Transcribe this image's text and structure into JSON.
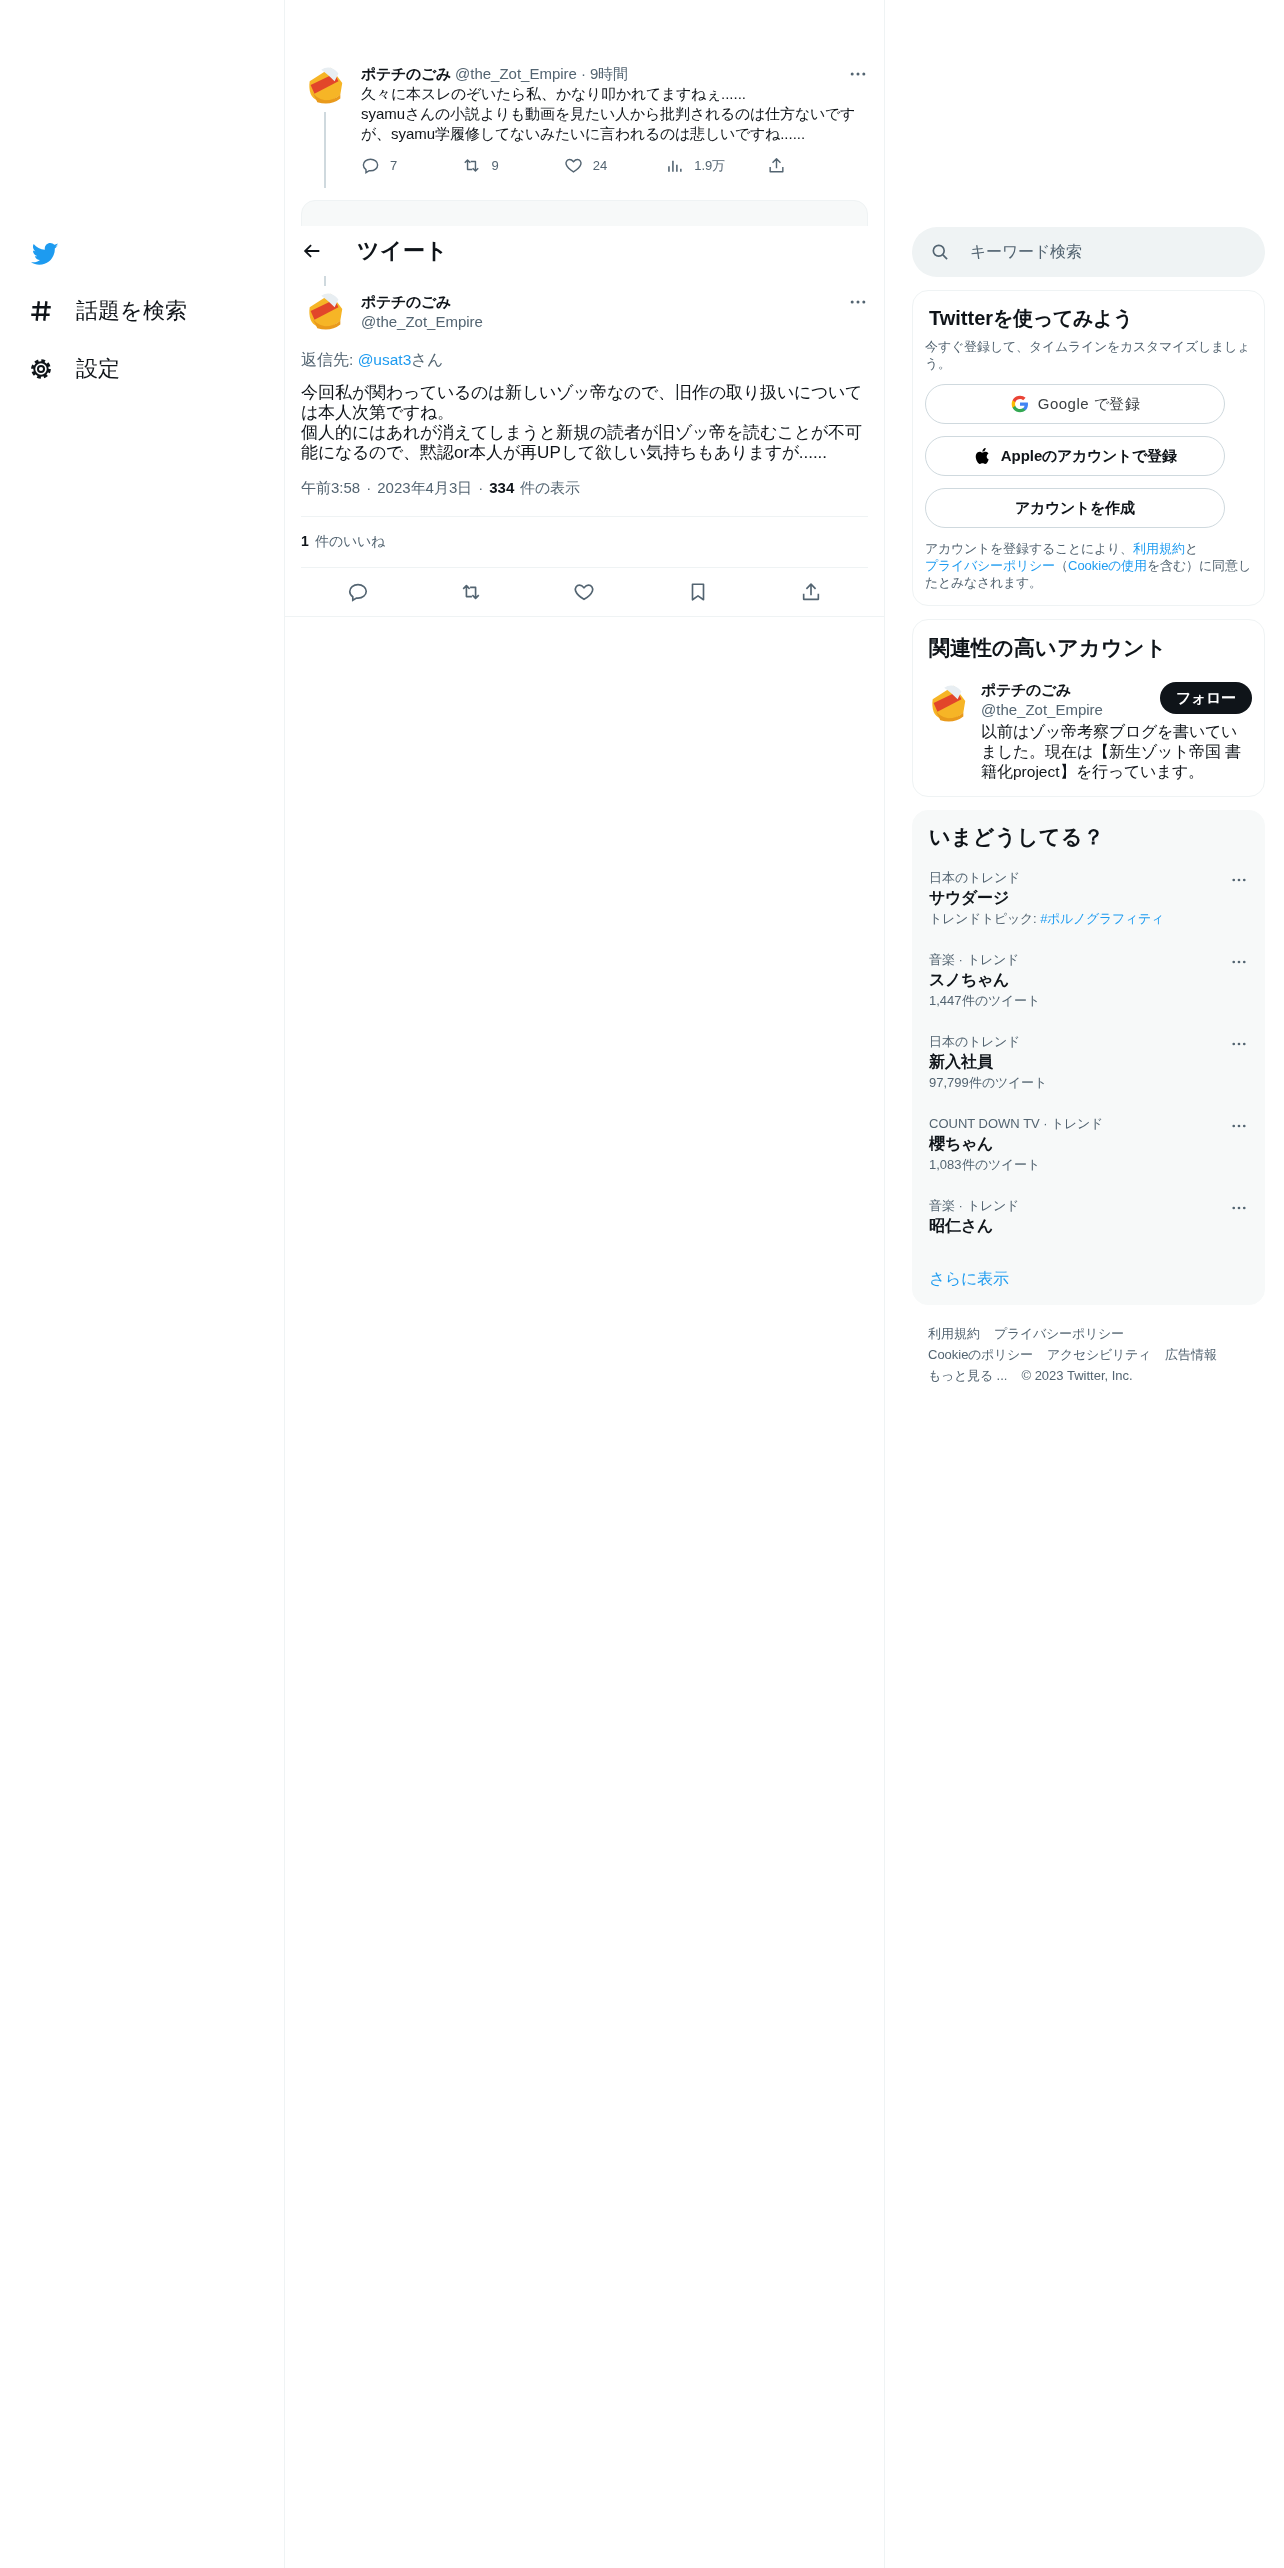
{
  "nav": {
    "items": [
      {
        "kind": "explore",
        "label": "話題を検索"
      },
      {
        "kind": "settings",
        "label": "設定"
      }
    ]
  },
  "parent_tweet": {
    "name": "ポテチのごみ",
    "handle": "@the_Zot_Empire",
    "dot": "·",
    "time": "9時間",
    "text": [
      "久々に本スレのぞいたら私、かなり叩かれてますねぇ......",
      "syamuさんの小説よりも動画を見たい人から批判されるのは仕方ないですが、syamu学履修してないみたいに言われるのは悲しいですね......"
    ],
    "actions": [
      {
        "kind": "reply",
        "count": "7"
      },
      {
        "kind": "retweet",
        "count": "9"
      },
      {
        "kind": "like",
        "count": "24"
      },
      {
        "kind": "views",
        "count": "1.9万"
      },
      {
        "kind": "share"
      }
    ]
  },
  "header": {
    "title": "ツイート"
  },
  "tweet": {
    "name": "ポテチのごみ",
    "handle": "@the_Zot_Empire",
    "reply_to": {
      "prefix": "返信先: ",
      "mention": "@usat3",
      "suffix": "さん"
    },
    "text": [
      "今回私が関わっているのは新しいゾッ帝なので、旧作の取り扱いについては本人次第ですね。",
      "個人的にはあれが消えてしまうと新規の読者が旧ゾッ帝を読むことが不可能になるので、黙認or本人が再UPして欲しい気持ちもありますが......"
    ],
    "time": "午前3:58",
    "date": "2023年4月3日",
    "dot": "·",
    "views_count": "334",
    "views_label": "件の表示",
    "likes_count": "1",
    "likes_label": "件のいいね",
    "actions": [
      {
        "kind": "reply"
      },
      {
        "kind": "retweet"
      },
      {
        "kind": "like"
      },
      {
        "kind": "bookmark"
      },
      {
        "kind": "share"
      }
    ]
  },
  "sidebar": {
    "search": {
      "placeholder": "キーワード検索"
    },
    "signup": {
      "title": "Twitterを使ってみよう",
      "subtitle": "今すぐ登録して、タイムラインをカスタマイズしましょう。",
      "buttons": [
        {
          "kind": "google",
          "label": "Google で登録"
        },
        {
          "kind": "apple",
          "label": "Appleのアカウントで登録"
        },
        {
          "kind": "create",
          "label": "アカウントを作成"
        }
      ],
      "legal": [
        {
          "text": "アカウントを登録することにより、",
          "link": false
        },
        {
          "text": "利用規約",
          "link": true
        },
        {
          "text": "と",
          "link": false
        },
        {
          "text": "プライバシーポリシー",
          "link": true
        },
        {
          "text": "（",
          "link": false
        },
        {
          "text": "Cookieの使用",
          "link": true
        },
        {
          "text": "を含む）に同意したとみなされます。",
          "link": false
        }
      ]
    },
    "relevant": {
      "title": "関連性の高いアカウント",
      "name": "ポテチのごみ",
      "handle": "@the_Zot_Empire",
      "follow": "フォロー",
      "bio": "以前はゾッ帝考察ブログを書いていました。現在は【新生ゾット帝国 書籍化project】を行っています。"
    },
    "trends": {
      "title": "いまどうしてる？",
      "items": [
        {
          "context": "日本のトレンド",
          "name": "サウダージ",
          "topic_prefix": "トレンドトピック: ",
          "topic": "#ポルノグラフィティ"
        },
        {
          "context": "音楽 · トレンド",
          "name": "スノちゃん",
          "count": "1,447件のツイート"
        },
        {
          "context": "日本のトレンド",
          "name": "新入社員",
          "count": "97,799件のツイート"
        },
        {
          "context": "COUNT DOWN TV · トレンド",
          "name": "櫻ちゃん",
          "count": "1,083件のツイート"
        },
        {
          "context": "音楽 · トレンド",
          "name": "昭仁さん"
        }
      ],
      "more": "さらに表示"
    },
    "footer": {
      "lines": [
        [
          "利用規約",
          "プライバシーポリシー"
        ],
        [
          "Cookieのポリシー",
          "アクセシビリティ",
          "広告情報"
        ],
        [
          "もっと見る ...",
          "© 2023 Twitter, Inc."
        ]
      ]
    }
  }
}
